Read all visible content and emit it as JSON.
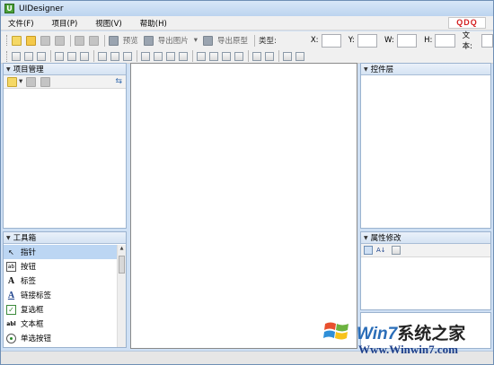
{
  "window": {
    "title": "UIDesigner",
    "app_icon": "U"
  },
  "menu": {
    "items": [
      "文件(F)",
      "项目(P)",
      "视图(V)",
      "帮助(H)"
    ],
    "brand_logo": "QDQ"
  },
  "toolbar1": {
    "preview": "预览",
    "export_image": "导出图片",
    "export_prototype": "导出原型",
    "type_label": "类型:",
    "x_label": "X:",
    "y_label": "Y:",
    "w_label": "W:",
    "h_label": "H:",
    "text_label": "文本:"
  },
  "panels": {
    "project": "项目管理",
    "toolbox": "工具箱",
    "layers": "控件层",
    "properties": "属性修改"
  },
  "toolbox_items": [
    {
      "label": "指针",
      "icon": "pointer-icon",
      "glyph": "↖"
    },
    {
      "label": "按钮",
      "icon": "button-icon",
      "glyph": "ab"
    },
    {
      "label": "标签",
      "icon": "label-icon",
      "glyph": "A"
    },
    {
      "label": "链接标签",
      "icon": "link-label-icon",
      "glyph": "A"
    },
    {
      "label": "复选框",
      "icon": "checkbox-icon",
      "glyph": "✓"
    },
    {
      "label": "文本框",
      "icon": "textbox-icon",
      "glyph": "abl"
    },
    {
      "label": "单选按钮",
      "icon": "radio-icon",
      "glyph": ""
    }
  ],
  "watermark": {
    "brand_win7": "Win7",
    "brand_cn": "系统之家",
    "url": "Www.Winwin7.com"
  },
  "colors": {
    "window_frame": "#cfe0f4",
    "brand_red": "#d42121",
    "watermark_blue": "#2a6db8"
  }
}
